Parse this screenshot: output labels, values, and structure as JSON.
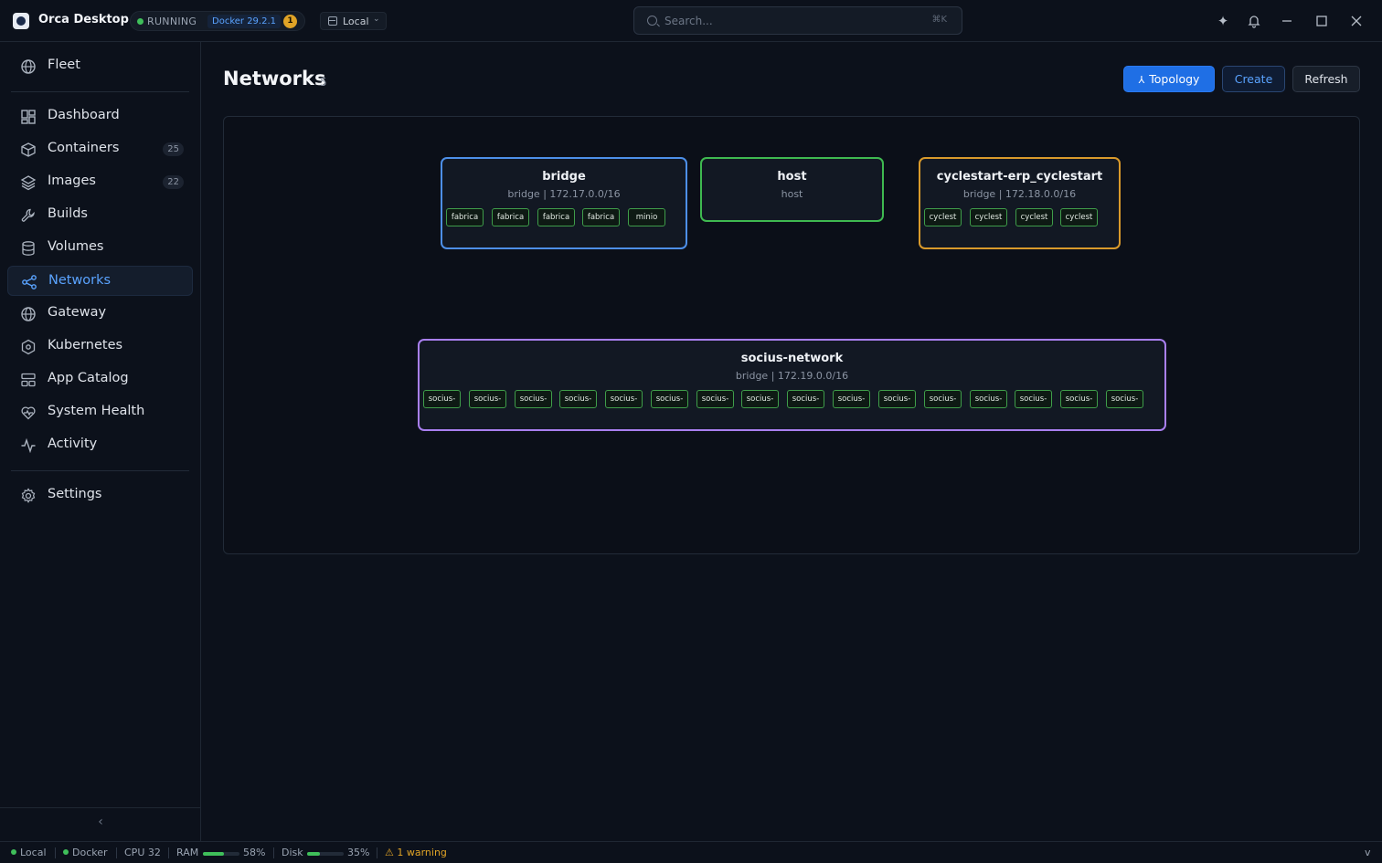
{
  "app": {
    "title": "Orca Desktop",
    "status": "RUNNING",
    "docker_version": "Docker 29.2.1",
    "notification_count": "1",
    "context": "Local"
  },
  "search": {
    "placeholder": "Search...",
    "shortcut": "⌘K"
  },
  "sidebar": {
    "items": [
      {
        "label": "Fleet",
        "icon": "globe-icon"
      },
      {
        "label": "Dashboard",
        "icon": "dashboard-icon"
      },
      {
        "label": "Containers",
        "icon": "box-icon",
        "badge": "25"
      },
      {
        "label": "Images",
        "icon": "layers-icon",
        "badge": "22"
      },
      {
        "label": "Builds",
        "icon": "wrench-icon"
      },
      {
        "label": "Volumes",
        "icon": "database-icon"
      },
      {
        "label": "Networks",
        "icon": "share-icon",
        "active": true
      },
      {
        "label": "Gateway",
        "icon": "globe-icon"
      },
      {
        "label": "Kubernetes",
        "icon": "hexagon-icon"
      },
      {
        "label": "App Catalog",
        "icon": "catalog-icon"
      },
      {
        "label": "System Health",
        "icon": "heart-pulse-icon"
      },
      {
        "label": "Activity",
        "icon": "activity-icon"
      },
      {
        "label": "Settings",
        "icon": "gear-icon"
      }
    ]
  },
  "main": {
    "title": "Networks",
    "count": "5",
    "buttons": {
      "topology": "Topology",
      "create": "Create",
      "refresh": "Refresh"
    }
  },
  "networks": [
    {
      "name": "bridge",
      "sub": "bridge | 172.17.0.0/16",
      "color": "#4d8fe8",
      "containers": [
        "fabrica",
        "fabrica",
        "fabrica",
        "fabrica",
        "minio"
      ]
    },
    {
      "name": "host",
      "sub": "host",
      "color": "#3fb950",
      "containers": []
    },
    {
      "name": "cyclestart-erp_cyclestart",
      "sub": "bridge | 172.18.0.0/16",
      "color": "#d99a2b",
      "containers": [
        "cyclest",
        "cyclest",
        "cyclest",
        "cyclest"
      ]
    },
    {
      "name": "socius-network",
      "sub": "bridge | 172.19.0.0/16",
      "color": "#a97ff0",
      "containers": [
        "socius-",
        "socius-",
        "socius-",
        "socius-",
        "socius-",
        "socius-",
        "socius-",
        "socius-",
        "socius-",
        "socius-",
        "socius-",
        "socius-",
        "socius-",
        "socius-",
        "socius-",
        "socius-"
      ]
    }
  ],
  "statusbar": {
    "context": "Local",
    "engine": "Docker",
    "cpu": "CPU 32",
    "ram_label": "RAM",
    "ram_pct": "58%",
    "ram_value": 58,
    "disk_label": "Disk",
    "disk_pct": "35%",
    "disk_value": 35,
    "warning": "1 warning",
    "version": "v"
  }
}
